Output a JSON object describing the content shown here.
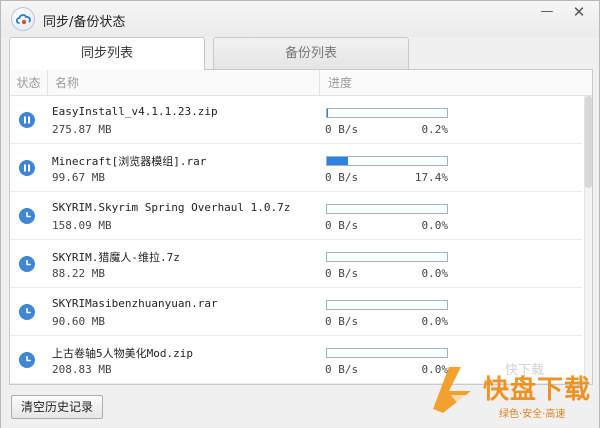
{
  "window": {
    "title": "同步/备份状态"
  },
  "tabs": [
    {
      "label": "同步列表",
      "active": true
    },
    {
      "label": "备份列表",
      "active": false
    }
  ],
  "table": {
    "headers": {
      "status": "状态",
      "name": "名称",
      "progress": "进度"
    },
    "rows": [
      {
        "status_icon": "pause-icon",
        "name": "EasyInstall_v4.1.1.23.zip",
        "size": "275.87 MB",
        "speed": "0 B/s",
        "percent": "0.2%",
        "progress": 0.002
      },
      {
        "status_icon": "pause-icon",
        "name": "Minecraft[浏览器模组].rar",
        "size": "99.67 MB",
        "speed": "0 B/s",
        "percent": "17.4%",
        "progress": 0.174
      },
      {
        "status_icon": "clock-icon",
        "name": "SKYRIM.Skyrim Spring Overhaul 1.0.7z",
        "size": "158.09 MB",
        "speed": "0 B/s",
        "percent": "0.0%",
        "progress": 0.0
      },
      {
        "status_icon": "clock-icon",
        "name": "SKYRIM.猎魔人-维拉.7z",
        "size": "88.22 MB",
        "speed": "0 B/s",
        "percent": "0.0%",
        "progress": 0.0
      },
      {
        "status_icon": "clock-icon",
        "name": "SKYRIMasibenzhuanyuan.rar",
        "size": "90.60 MB",
        "speed": "0 B/s",
        "percent": "0.0%",
        "progress": 0.0
      },
      {
        "status_icon": "clock-icon",
        "name": "上古卷轴5人物美化Mod.zip",
        "size": "208.83 MB",
        "speed": "0 B/s",
        "percent": "0.0%",
        "progress": 0.0
      }
    ]
  },
  "footer": {
    "clear_button": "清空历史记录"
  },
  "watermark": {
    "name": "快盘下载",
    "slogan": "绿色·安全·高速",
    "ghost_text": "快下载"
  },
  "colors": {
    "accent": "#2f83e0",
    "status_icon": "#3f86d4",
    "watermark": "#f08a12"
  }
}
